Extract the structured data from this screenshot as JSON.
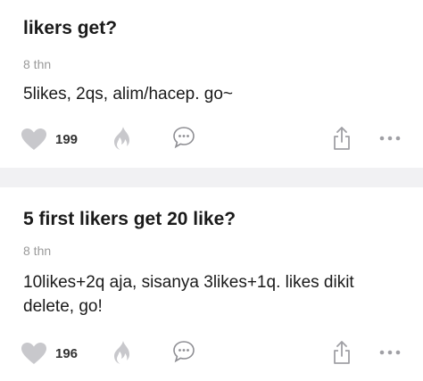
{
  "posts": [
    {
      "title": "likers get?",
      "time": "8 thn",
      "body": "5likes, 2qs, alim/hacep. go~",
      "likes": "199"
    },
    {
      "title": "5 first likers get 20 like?",
      "time": "8 thn",
      "body": "10likes+2q aja, sisanya 3likes+1q. likes dikit delete, go!",
      "likes": "196"
    }
  ],
  "icons": {
    "like": "heart-icon",
    "boost": "fire-icon",
    "comment": "chat-bubble-icon",
    "share": "share-icon",
    "more": "more-dots-icon"
  },
  "colors": {
    "icon_gray": "#c8c8cc",
    "divider": "#f1f1f3",
    "meta_text": "#9a9a9a"
  }
}
